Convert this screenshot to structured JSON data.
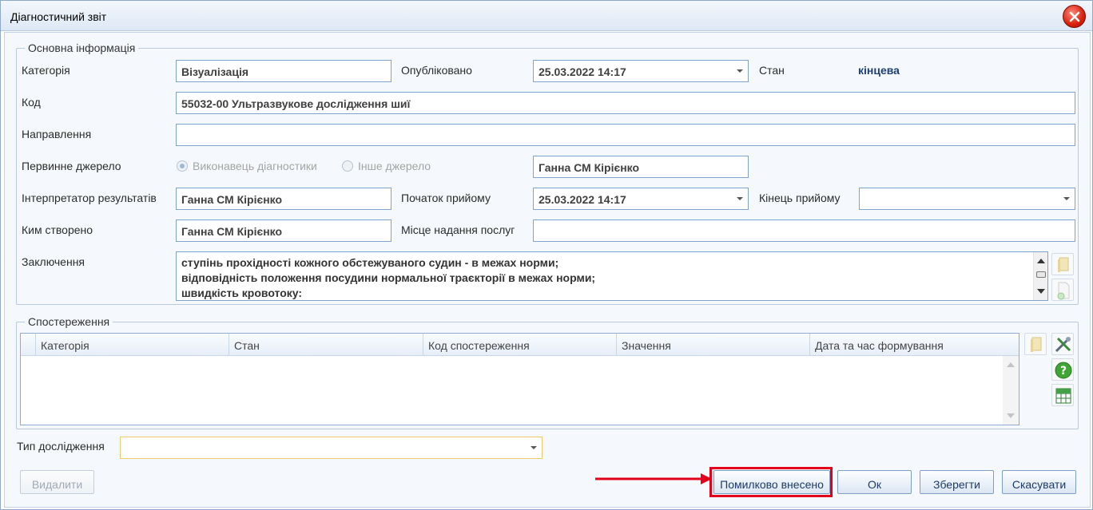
{
  "window": {
    "title": "Діагностичний звіт",
    "close_icon": "close-icon"
  },
  "main_info": {
    "legend": "Основна інформація",
    "category_label": "Категорія",
    "category_value": "Візуалізація",
    "published_label": "Опубліковано",
    "published_value": "25.03.2022 14:17",
    "state_label": "Стан",
    "state_value": "кінцева",
    "code_label": "Код",
    "code_value": "55032-00 Ультразвукове дослідження шиї",
    "referral_label": "Направлення",
    "referral_value": "",
    "primary_source_label": "Первинне джерело",
    "primary_source_options": [
      "Виконавець діагностики",
      "Інше джерело"
    ],
    "primary_source_selected": "Виконавець діагностики",
    "primary_source_value": "Ганна СМ Кірієнко",
    "interpreter_label": "Інтерпретатор результатів",
    "interpreter_value": "Ганна СМ Кірієнко",
    "visit_start_label": "Початок прийому",
    "visit_start_value": "25.03.2022 14:17",
    "visit_end_label": "Кінець прийому",
    "visit_end_value": "",
    "created_by_label": "Ким створено",
    "created_by_value": "Ганна СМ Кірієнко",
    "service_place_label": "Місце надання послуг",
    "service_place_value": "",
    "conclusion_label": "Заключення",
    "conclusion_lines": [
      "ступінь прохідності кожного обстежуваного судин - в межах норми;",
      "відповідність положення посудини нормальної траєкторії в межах норми;",
      "швидкість кровотоку:"
    ]
  },
  "observations": {
    "legend": "Спостереження",
    "columns": [
      "Категорія",
      "Стан",
      "Код спостереження",
      "Значення",
      "Дата та час формування"
    ],
    "rows": []
  },
  "study_type": {
    "label": "Тип дослідження",
    "value": ""
  },
  "buttons": {
    "delete": "Видалити",
    "entered_in_error": "Помилково внесено",
    "ok": "Ок",
    "save": "Зберегти",
    "cancel": "Скасувати"
  },
  "colors": {
    "accent_red": "#e3001b",
    "state_value": "#1f3f74",
    "field_border": "#7fa3cf"
  }
}
